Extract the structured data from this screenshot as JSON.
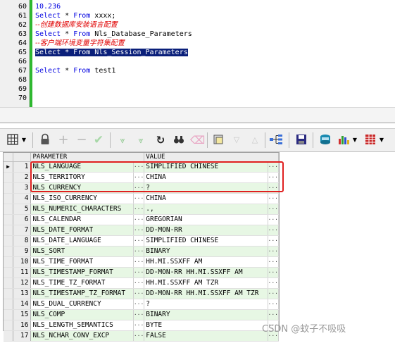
{
  "editor": {
    "lines": [
      {
        "num": "60",
        "segments": [
          {
            "t": "10.236",
            "c": "num"
          }
        ]
      },
      {
        "num": "61",
        "segments": [
          {
            "t": "Select",
            "c": "kw"
          },
          {
            "t": " * ",
            "c": "plain"
          },
          {
            "t": "From",
            "c": "kw"
          },
          {
            "t": " xxxx;",
            "c": "plain"
          }
        ]
      },
      {
        "num": "62",
        "segments": [
          {
            "t": "--创建数据库安装语言配置",
            "c": "cmt"
          }
        ]
      },
      {
        "num": "63",
        "segments": [
          {
            "t": "Select",
            "c": "kw"
          },
          {
            "t": " * ",
            "c": "plain"
          },
          {
            "t": "From",
            "c": "kw"
          },
          {
            "t": " Nls_Database_Parameters",
            "c": "plain"
          }
        ]
      },
      {
        "num": "64",
        "segments": [
          {
            "t": "--客户端环境变量字符集配置",
            "c": "cmt"
          }
        ]
      },
      {
        "num": "65",
        "segments": [
          {
            "t": "Select * From Nls_Session_Parameters",
            "c": "sel"
          }
        ]
      },
      {
        "num": "66",
        "segments": []
      },
      {
        "num": "67",
        "segments": [
          {
            "t": "Select",
            "c": "kw"
          },
          {
            "t": " * ",
            "c": "plain"
          },
          {
            "t": "From",
            "c": "kw"
          },
          {
            "t": " test1",
            "c": "plain"
          }
        ]
      },
      {
        "num": "68",
        "segments": []
      },
      {
        "num": "69",
        "segments": []
      },
      {
        "num": "70",
        "segments": []
      }
    ]
  },
  "toolbar": {
    "icons": [
      "grid-view-icon",
      "dropdown-arrow-icon",
      "lock-icon",
      "add-record-icon",
      "delete-record-icon",
      "post-record-icon",
      "fetch-next-icon",
      "fetch-last-icon",
      "refresh-icon",
      "find-icon",
      "clear-icon",
      "query-by-example-icon",
      "sort-down-icon",
      "sort-up-icon",
      "tree-view-icon",
      "save-icon",
      "export-icon",
      "chart-icon",
      "dropdown-arrow-icon",
      "grid-table-icon",
      "dropdown-arrow-icon"
    ]
  },
  "grid": {
    "columns": [
      "PARAMETER",
      "VALUE"
    ],
    "rows": [
      {
        "n": "1",
        "p": "NLS_LANGUAGE",
        "v": "SIMPLIFIED CHINESE"
      },
      {
        "n": "2",
        "p": "NLS_TERRITORY",
        "v": "CHINA"
      },
      {
        "n": "3",
        "p": "NLS_CURRENCY",
        "v": "?"
      },
      {
        "n": "4",
        "p": "NLS_ISO_CURRENCY",
        "v": "CHINA"
      },
      {
        "n": "5",
        "p": "NLS_NUMERIC_CHARACTERS",
        "v": ".,"
      },
      {
        "n": "6",
        "p": "NLS_CALENDAR",
        "v": "GREGORIAN"
      },
      {
        "n": "7",
        "p": "NLS_DATE_FORMAT",
        "v": "DD-MON-RR"
      },
      {
        "n": "8",
        "p": "NLS_DATE_LANGUAGE",
        "v": "SIMPLIFIED CHINESE"
      },
      {
        "n": "9",
        "p": "NLS_SORT",
        "v": "BINARY"
      },
      {
        "n": "10",
        "p": "NLS_TIME_FORMAT",
        "v": "HH.MI.SSXFF AM"
      },
      {
        "n": "11",
        "p": "NLS_TIMESTAMP_FORMAT",
        "v": "DD-MON-RR HH.MI.SSXFF AM"
      },
      {
        "n": "12",
        "p": "NLS_TIME_TZ_FORMAT",
        "v": "HH.MI.SSXFF AM TZR"
      },
      {
        "n": "13",
        "p": "NLS_TIMESTAMP_TZ_FORMAT",
        "v": "DD-MON-RR HH.MI.SSXFF AM TZR"
      },
      {
        "n": "14",
        "p": "NLS_DUAL_CURRENCY",
        "v": "?"
      },
      {
        "n": "15",
        "p": "NLS_COMP",
        "v": "BINARY"
      },
      {
        "n": "16",
        "p": "NLS_LENGTH_SEMANTICS",
        "v": "BYTE"
      },
      {
        "n": "17",
        "p": "NLS_NCHAR_CONV_EXCP",
        "v": "FALSE"
      }
    ],
    "ellipsis": "···",
    "current_row_marker": "▶"
  },
  "watermark": "CSDN @蚊子不吸吸"
}
